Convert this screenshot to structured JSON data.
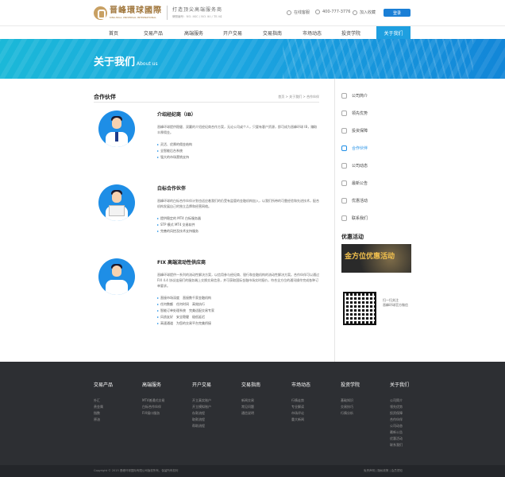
{
  "header": {
    "logo_cn": "晋峰環球國際",
    "logo_en": "KING BALL UNIVERSAL INTERNATIONAL",
    "slogan": "打造顶尖高端服务商",
    "slogan_sub": "牌照编号：NO. 8SC / NO. 80 / TS 04",
    "online_service": "在线客服",
    "phone": "400-777-3776",
    "favorite": "加入收藏",
    "login": "登录"
  },
  "nav": {
    "items": [
      {
        "label": "首页"
      },
      {
        "label": "交易产品"
      },
      {
        "label": "高端服务"
      },
      {
        "label": "开户交易"
      },
      {
        "label": "交易指南"
      },
      {
        "label": "市场动态"
      },
      {
        "label": "投资学院"
      },
      {
        "label": "关于我们"
      }
    ],
    "active_index": 7
  },
  "banner": {
    "title_cn": "关于我们",
    "title_en": "About us"
  },
  "content": {
    "title": "合作伙伴",
    "breadcrumb": "首页 > 关于我们 > 合作伙伴",
    "partners": [
      {
        "title": "介绍经纪商（IB）",
        "desc": "晋峰环球提供稳健、双赢的介绍经纪商合作方案，无论公司或个人，只要有客户资源，即可成为晋峰环球 IB，赚取丰厚佣金。",
        "bullets": [
          "灵活、优厚的佣金结构",
          "全智能后台系统",
          "强大的市场营销支持"
        ]
      },
      {
        "title": "白标合作伙伴",
        "desc": "晋峰环球的白标合作伙伴计划也适应着我们的仍受有监管的金融机构加入，以我们所带的可靠经验和先进技术，配合机构发展自己的独立品牌和经营网络。",
        "bullets": [
          "提供稳定的 MT4 白标服务器",
          "STP 模式 MT4 交易软件",
          "完善的风控及技术支持服务"
        ]
      },
      {
        "title": "FIX 高端流动性供应商",
        "desc": "晋峰环球提供一系列的流动性解决方案，以信用参与经纪商、银行和金融机构的流动性解决方案。合作伙伴可以通过 FIX 4.4 协议连接们的服务端上交换交易信息，并可获取国际金融市场实时报价，符合全方位的通讯操作完成各种订单要求。",
        "bullets": [
          "直接市场深度　直接数千家金融机构",
          "任何数额　任何时间　高效执行",
          "智能订单处理系统　完美适配交易专家",
          "风浪友好　安全稳健　极低延迟",
          "高速通道　为您的交易平台完美桥接"
        ]
      }
    ]
  },
  "sidebar": {
    "items": [
      {
        "label": "公司简介"
      },
      {
        "label": "领先优势"
      },
      {
        "label": "投资保障"
      },
      {
        "label": "合作伙伴"
      },
      {
        "label": "公司动态"
      },
      {
        "label": "最新公告"
      },
      {
        "label": "优惠活动"
      },
      {
        "label": "联系我们"
      }
    ],
    "active_index": 3,
    "promo_title": "优惠活动",
    "promo_text": "金方位优惠活动",
    "qr_text_1": "扫一扫关注",
    "qr_text_2": "晋峰环球官方微信"
  },
  "footer": {
    "columns": [
      {
        "title": "交易产品",
        "links": [
          "外汇",
          "贵金属",
          "指数",
          "原油"
        ]
      },
      {
        "title": "高端服务",
        "links": [
          "MT4普通式交易",
          "白标合作伙伴",
          "FIX接口服务"
        ]
      },
      {
        "title": "开户交易",
        "links": [
          "开立真实账户",
          "开立模拟账户",
          "存款流程",
          "取款流程",
          "帮助流程"
        ]
      },
      {
        "title": "交易指南",
        "links": [
          "新闻交易",
          "常见问题",
          "通信说明"
        ]
      },
      {
        "title": "市场动态",
        "links": [
          "行情走势",
          "专业解读",
          "市场评论",
          "重大新闻"
        ]
      },
      {
        "title": "投资学院",
        "links": [
          "基础知识",
          "交易技巧",
          "行情分析"
        ]
      },
      {
        "title": "关于我们",
        "links": [
          "公司简介",
          "领先优势",
          "投资保障",
          "合作伙伴",
          "公司动态",
          "最新公告",
          "优惠活动",
          "联系我们"
        ]
      }
    ],
    "copyright": "Copyright © 2015 晋峰环球国际有限公司版权所有，保留所有权利",
    "right_links": "免责声明 | 隐私政策 | 会员须知"
  }
}
